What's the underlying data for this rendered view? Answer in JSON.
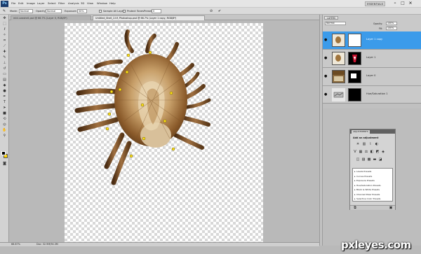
{
  "menubar": {
    "logo": "Ps",
    "items": [
      "File",
      "Edit",
      "Image",
      "Layer",
      "Select",
      "Filter",
      "Analysis",
      "3D",
      "View",
      "Window",
      "Help"
    ],
    "workspace": "ESSENTIALS",
    "buttons": [
      "–",
      "□",
      "×"
    ]
  },
  "options": {
    "mode_label": "Mode:",
    "mode_value": "Normal",
    "opacity_label": "Opacity:",
    "opacity_value": "100%",
    "brush_label": "Density:",
    "brush_value": "Normal",
    "size_label": "Exposure:",
    "size_value": "50%",
    "check1_label": "Sample All Layers",
    "check2_label": "Protect Tones",
    "preset_label": "Preset:",
    "preset_value": "0"
  },
  "tabs": [
    {
      "label": "mini-seashell.psd @ 66.7% (Layer 0, RGB/8*)",
      "active": false
    },
    {
      "label": "Untitled_Shell_2.tif, Photoshop.psd @ 66.7% (Layer 1 copy, RGB/8*)",
      "active": true
    }
  ],
  "status": {
    "zoom": "66.67%",
    "doc": "Doc: 32.9M/94.3M"
  },
  "layers": {
    "tab": "LAYERS",
    "blend": "Normal",
    "opacity_label": "Opacity:",
    "opacity_value": "100%",
    "fill_label": "Fill:",
    "fill_value": "100%",
    "rows": [
      {
        "name": "Layer 1 copy",
        "selected": true
      },
      {
        "name": "Layer 1",
        "selected": false
      },
      {
        "name": "Layer 0",
        "selected": false
      },
      {
        "name": "Hue/Saturation 1",
        "selected": false
      }
    ]
  },
  "adjustments": {
    "tab": "ADJUSTMENTS",
    "title": "Add an adjustment",
    "presets": [
      "Levels Presets",
      "Curves Presets",
      "Exposure Presets",
      "Hue/Saturation Presets",
      "Black & White Presets",
      "Channel Mixer Presets",
      "Selective Color Presets"
    ]
  },
  "watermark": "pxleyes.com",
  "colors": {
    "foreground": "#000000",
    "background": "#ffd400",
    "selection": "#3b9bea"
  }
}
